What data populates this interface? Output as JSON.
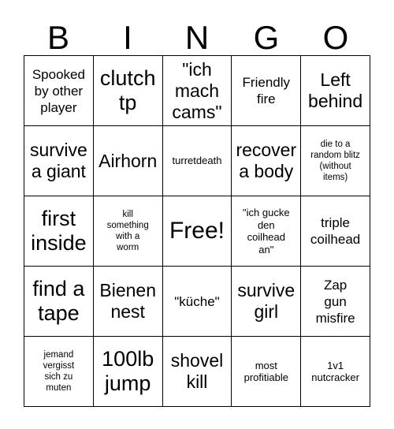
{
  "card": {
    "title": "BINGO",
    "header_letters": [
      "B",
      "I",
      "N",
      "G",
      "O"
    ],
    "free_space_label": "Free!",
    "rows": [
      [
        {
          "text": "Spooked\nby other\nplayer",
          "size": "fs-md",
          "free": false
        },
        {
          "text": "clutch\ntp",
          "size": "fs-xl",
          "free": false
        },
        {
          "text": "\"ich\nmach\ncams\"",
          "size": "fs-lg",
          "free": false
        },
        {
          "text": "Friendly\nfire",
          "size": "fs-md",
          "free": false
        },
        {
          "text": "Left\nbehind",
          "size": "fs-lg",
          "free": false
        }
      ],
      [
        {
          "text": "survive\na giant",
          "size": "fs-lg",
          "free": false
        },
        {
          "text": "Airhorn",
          "size": "fs-lg",
          "free": false
        },
        {
          "text": "turretdeath",
          "size": "fs-sm",
          "free": false
        },
        {
          "text": "recover\na body",
          "size": "fs-lg",
          "free": false
        },
        {
          "text": "die to a\nrandom blitz\n(without\nitems)",
          "size": "fs-xs",
          "free": false
        }
      ],
      [
        {
          "text": "first\ninside",
          "size": "fs-xl",
          "free": false
        },
        {
          "text": "kill\nsomething\nwith a\nworm",
          "size": "fs-xs",
          "free": false
        },
        {
          "text": "Free!",
          "size": "fs-free",
          "free": true
        },
        {
          "text": "\"ich gucke\nden\ncoilhead\nan\"",
          "size": "fs-sm",
          "free": false
        },
        {
          "text": "triple\ncoilhead",
          "size": "fs-md",
          "free": false
        }
      ],
      [
        {
          "text": "find a\ntape",
          "size": "fs-xl",
          "free": false
        },
        {
          "text": "Bienen\nnest",
          "size": "fs-lg",
          "free": false
        },
        {
          "text": "\"küche\"",
          "size": "fs-md",
          "free": false
        },
        {
          "text": "survive\ngirl",
          "size": "fs-lg",
          "free": false
        },
        {
          "text": "Zap\ngun\nmisfire",
          "size": "fs-md",
          "free": false
        }
      ],
      [
        {
          "text": "jemand\nvergisst\nsich zu\nmuten",
          "size": "fs-xs",
          "free": false
        },
        {
          "text": "100lb\njump",
          "size": "fs-xl",
          "free": false
        },
        {
          "text": "shovel\nkill",
          "size": "fs-lg",
          "free": false
        },
        {
          "text": "most\nprofitiable",
          "size": "fs-sm",
          "free": false
        },
        {
          "text": "1v1\nnutcracker",
          "size": "fs-sm",
          "free": false
        }
      ]
    ]
  }
}
